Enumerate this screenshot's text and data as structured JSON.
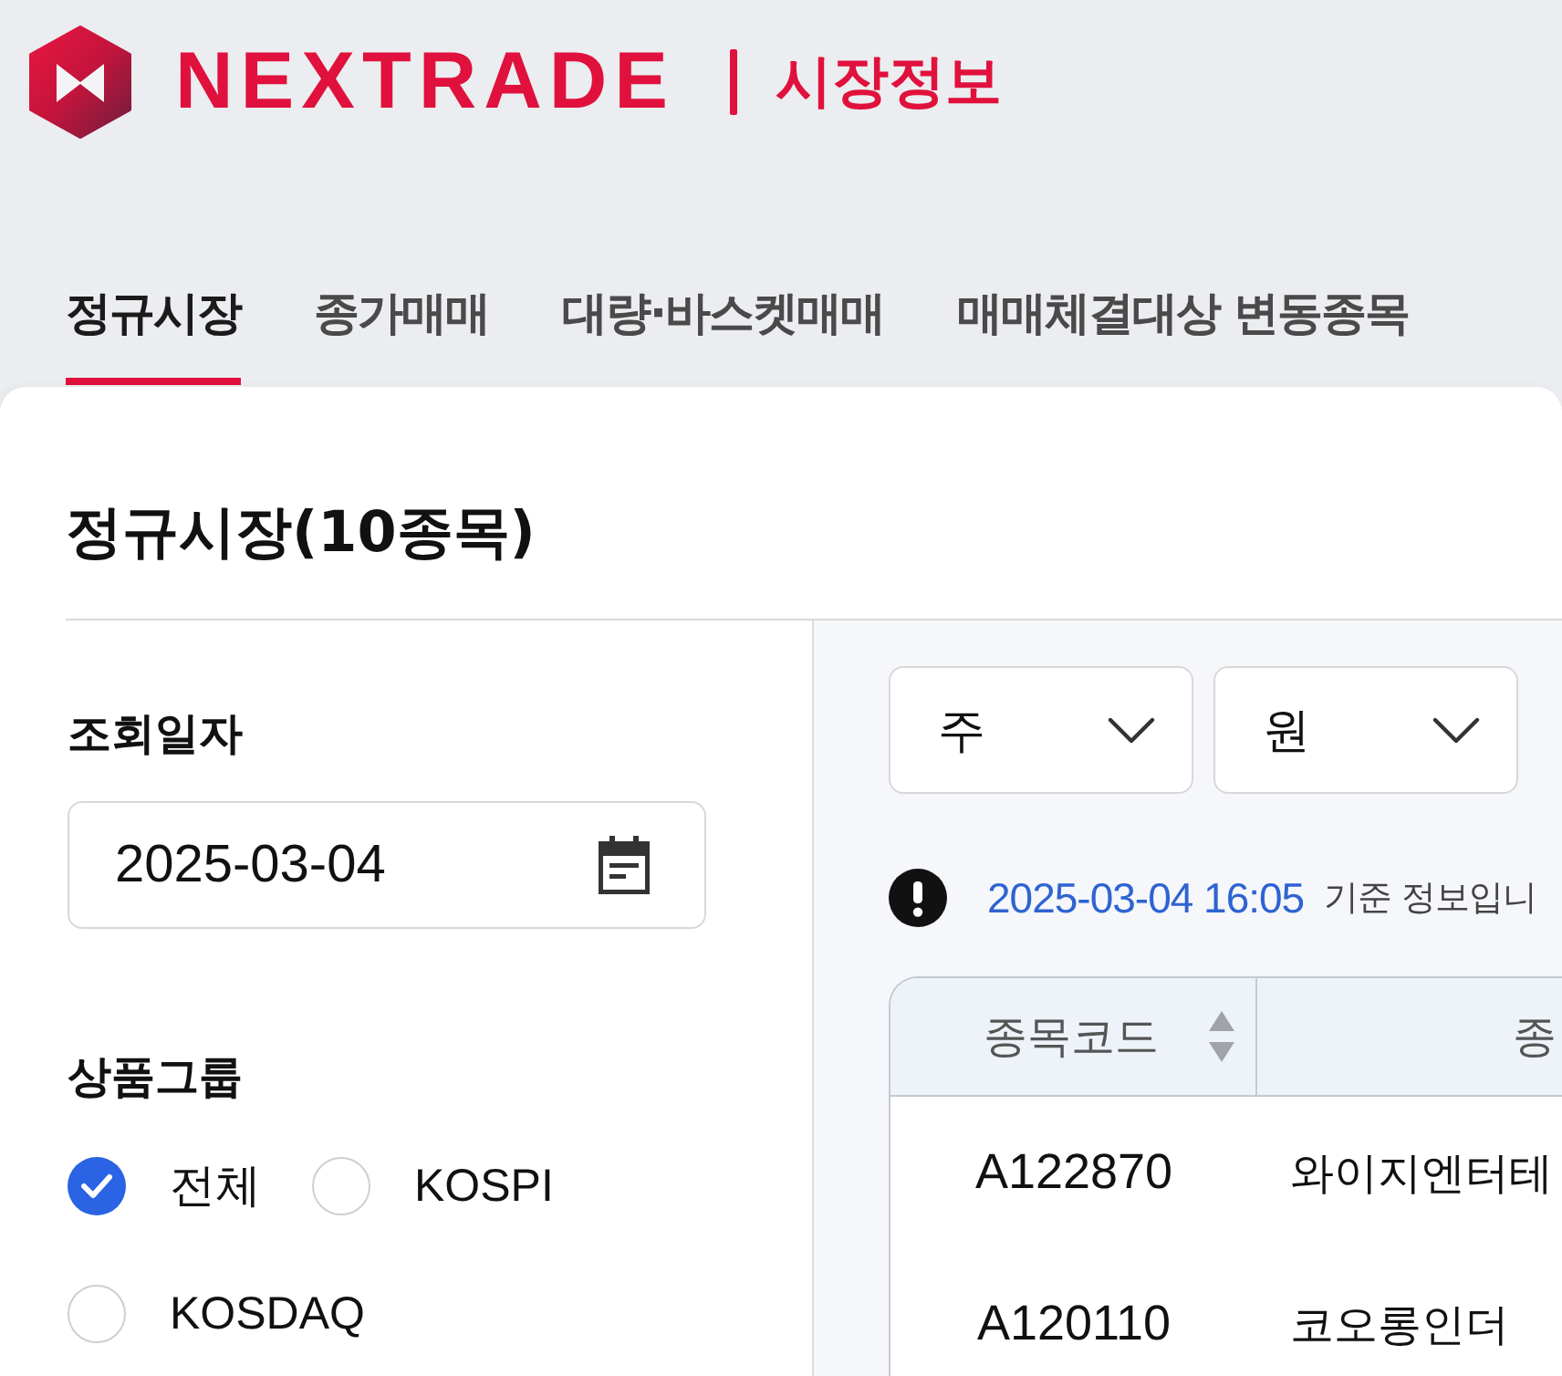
{
  "header": {
    "logo_text": "NEXTRADE",
    "section_title": "시장정보"
  },
  "tabs": [
    {
      "label": "정규시장",
      "selected": true
    },
    {
      "label": "종가매매",
      "selected": false
    },
    {
      "label": "대량·바스켓매매",
      "selected": false
    },
    {
      "label": "매매체결대상 변동종목",
      "selected": false
    }
  ],
  "page_title": "정규시장(10종목)",
  "filters": {
    "date": {
      "label": "조회일자",
      "value": "2025-03-04"
    },
    "product_group": {
      "label": "상품그룹",
      "options": [
        {
          "label": "전체",
          "selected": true
        },
        {
          "label": "KOSPI",
          "selected": false
        },
        {
          "label": "KOSDAQ",
          "selected": false
        }
      ]
    }
  },
  "unit_selects": [
    {
      "value": "주"
    },
    {
      "value": "원"
    }
  ],
  "notice": {
    "timestamp": "2025-03-04 16:05",
    "text": "기준 정보입니"
  },
  "table": {
    "columns": [
      {
        "label": "종목코드",
        "sortable": true
      },
      {
        "label": "종",
        "sortable": false
      }
    ],
    "rows": [
      [
        "A122870",
        "와이지엔터테"
      ],
      [
        "A120110",
        "코오롱인더"
      ]
    ]
  }
}
